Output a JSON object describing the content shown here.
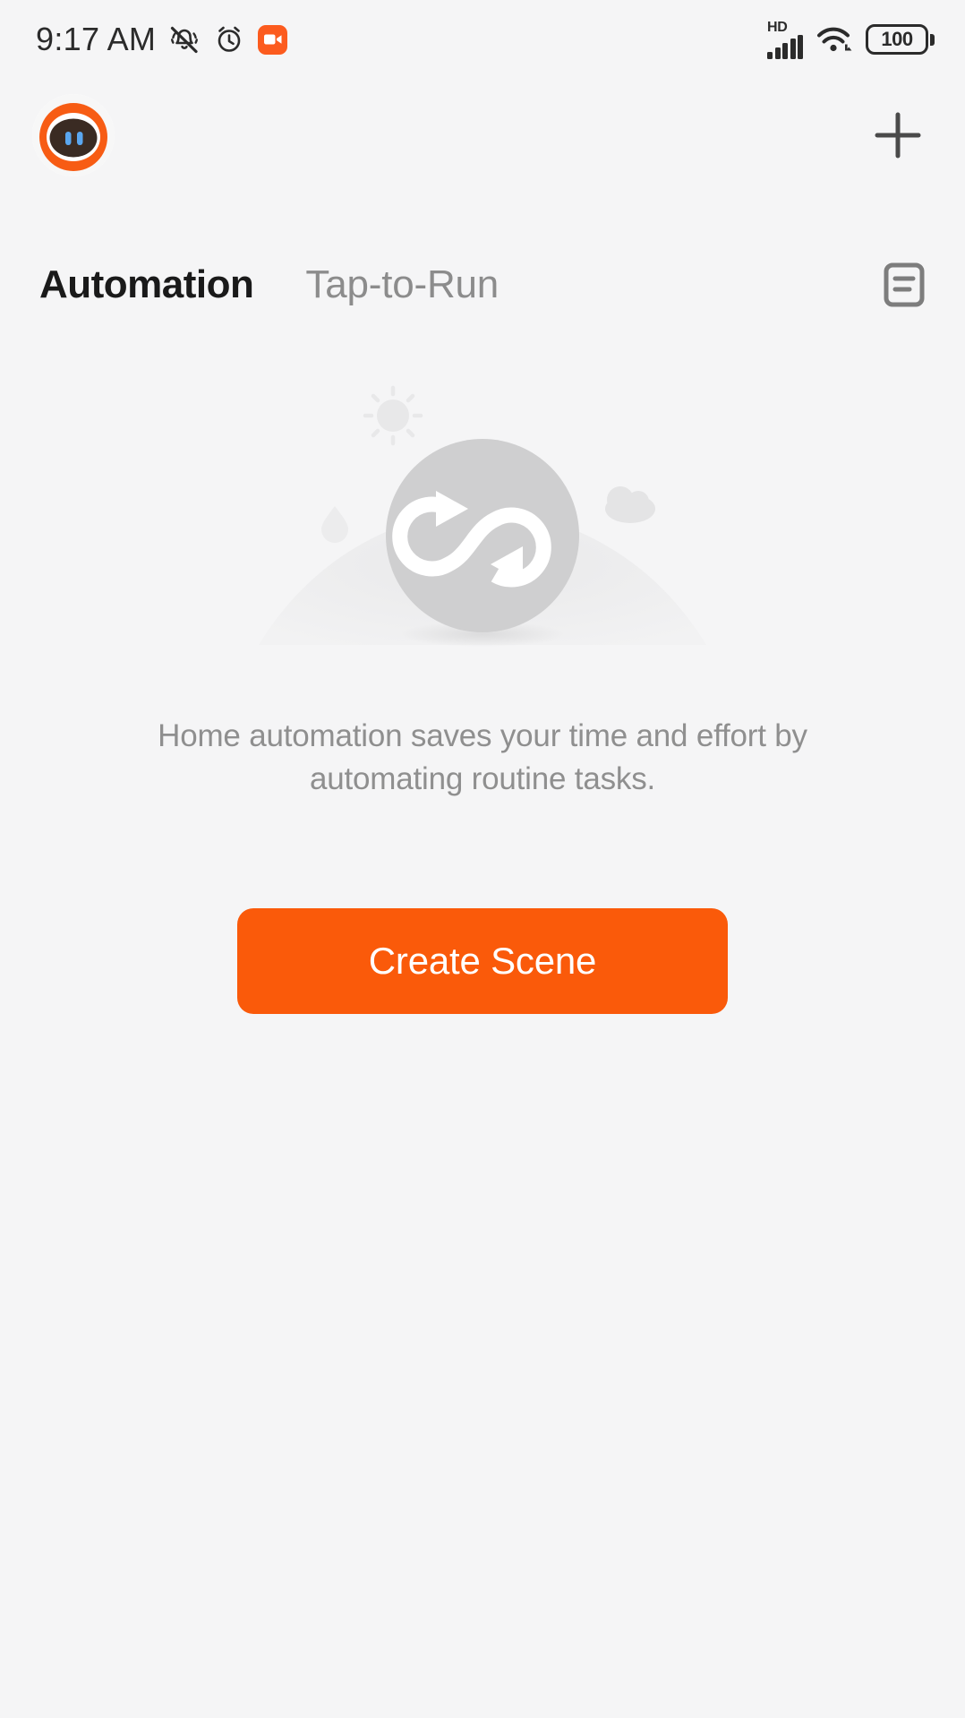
{
  "status_bar": {
    "time": "9:17 AM",
    "icons": {
      "mute": "bell-mute-icon",
      "alarm": "alarm-clock-icon",
      "recording": "screen-recording-icon",
      "network_type": "HD",
      "signal": "signal-bars-icon",
      "wifi": "wifi-icon"
    },
    "battery_level": "100"
  },
  "header": {
    "avatar_name": "user-avatar",
    "add_label": "+"
  },
  "tabs": [
    {
      "label": "Automation",
      "active": true
    },
    {
      "label": "Tap-to-Run",
      "active": false
    }
  ],
  "log_button_name": "automation-log-icon",
  "empty_state": {
    "illustration_name": "automation-loop-illustration",
    "message": "Home automation saves your time and effort by automating routine tasks.",
    "button_label": "Create Scene"
  },
  "colors": {
    "background": "#f5f5f6",
    "accent_orange": "#fa5a0a",
    "recording_orange": "#fc5b1e",
    "tab_active": "#1a1a1a",
    "tab_inactive": "#8c8c8c",
    "body_text": "#8f8f8f",
    "illustration_gray": "#cccccc"
  }
}
